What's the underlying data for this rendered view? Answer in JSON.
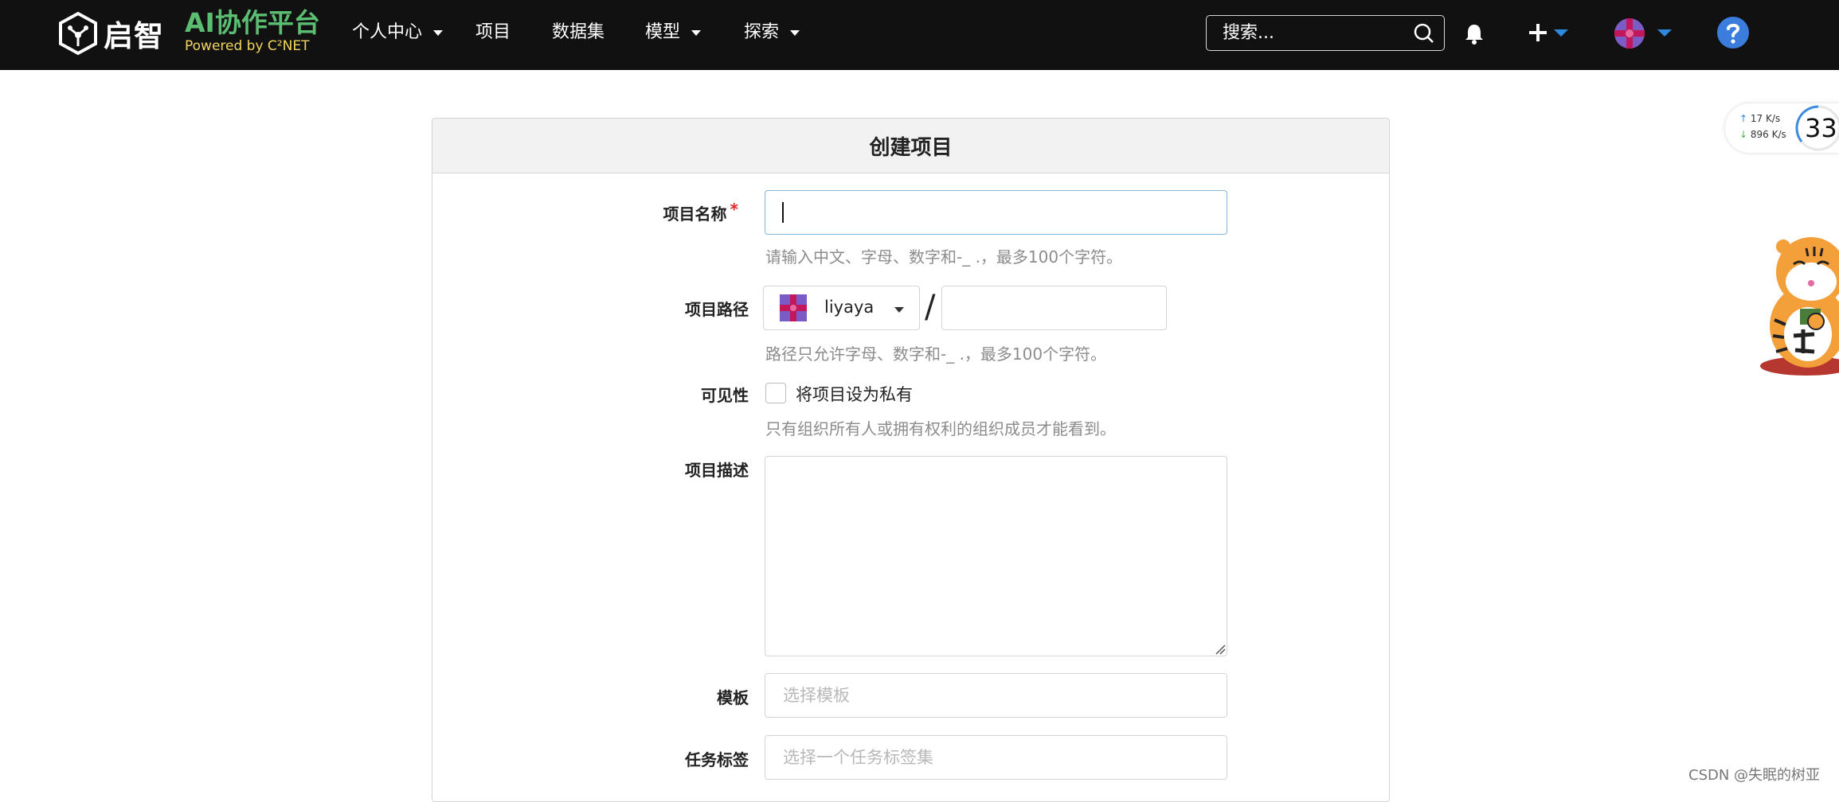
{
  "nav": {
    "logo_text": "启智",
    "brand_title": "AI协作平台",
    "brand_subtitle": "Powered by C²NET",
    "items": [
      {
        "label": "个人中心",
        "dropdown": true
      },
      {
        "label": "项目",
        "dropdown": false
      },
      {
        "label": "数据集",
        "dropdown": false
      },
      {
        "label": "模型",
        "dropdown": true
      },
      {
        "label": "探索",
        "dropdown": true
      }
    ],
    "search_placeholder": "搜索...",
    "icons": [
      "search-icon",
      "bell-icon",
      "plus-icon",
      "avatar",
      "help-icon"
    ],
    "accent_color": "#2f88e0"
  },
  "network_widget": {
    "upload": "17  K/s",
    "download": "896 K/s",
    "percent": "33"
  },
  "form": {
    "title": "创建项目",
    "fields": {
      "name": {
        "label": "项目名称",
        "required_mark": "*",
        "value": "",
        "help": "请输入中文、字母、数字和-_ .，最多100个字符。"
      },
      "path": {
        "label": "项目路径",
        "owner": "liyaya",
        "separator": "/",
        "value": "",
        "help": "路径只允许字母、数字和-_ .，最多100个字符。"
      },
      "visibility": {
        "label": "可见性",
        "checkbox_label": "将项目设为私有",
        "checked": false,
        "help": "只有组织所有人或拥有权利的组织成员才能看到。"
      },
      "description": {
        "label": "项目描述",
        "value": ""
      },
      "template": {
        "label": "模板",
        "placeholder": "选择模板"
      },
      "task_tags": {
        "label": "任务标签",
        "placeholder": "选择一个任务标签集"
      }
    }
  },
  "watermark": "CSDN @失眠的树亚"
}
